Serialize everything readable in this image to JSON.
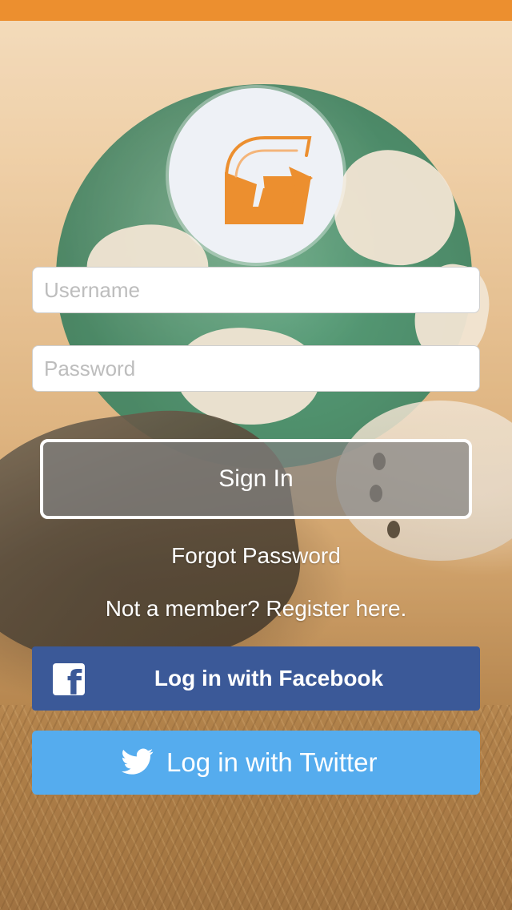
{
  "header": {
    "accent": "#ec8f2f"
  },
  "logo": {
    "icon": "g-logo-icon",
    "color": "#ec8f2f"
  },
  "form": {
    "username_placeholder": "Username",
    "password_placeholder": "Password",
    "sign_in_label": "Sign In",
    "forgot_password_label": "Forgot Password",
    "register_label": "Not a member? Register here."
  },
  "social": {
    "facebook": {
      "label": "Log in with Facebook",
      "icon": "facebook-icon",
      "color": "#3b5998"
    },
    "twitter": {
      "label": "Log in with Twitter",
      "icon": "twitter-icon",
      "color": "#55acee"
    }
  }
}
